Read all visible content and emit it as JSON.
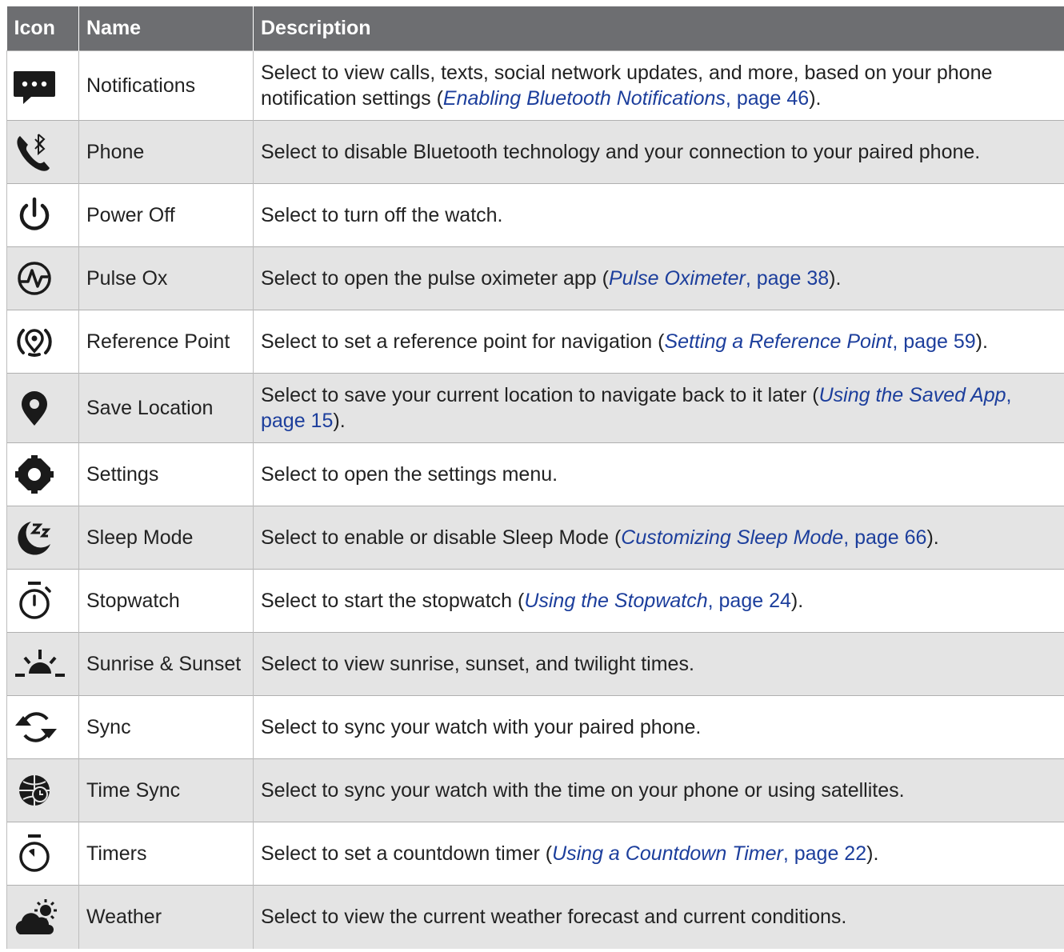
{
  "table": {
    "headers": {
      "icon": "Icon",
      "name": "Name",
      "description": "Description"
    },
    "rows": [
      {
        "icon": "notifications-icon",
        "name": "Notifications",
        "desc_before": "Select to view calls, texts, social network updates, and more, based on your phone notification settings (",
        "link_title": "Enabling Bluetooth Notifications",
        "link_page": ", page 46",
        "desc_after": ")."
      },
      {
        "icon": "phone-bluetooth-icon",
        "name": "Phone",
        "desc_before": "Select to disable Bluetooth technology and your connection to your paired phone.",
        "link_title": "",
        "link_page": "",
        "desc_after": ""
      },
      {
        "icon": "power-icon",
        "name": "Power Off",
        "desc_before": "Select to turn off the watch.",
        "link_title": "",
        "link_page": "",
        "desc_after": ""
      },
      {
        "icon": "pulse-ox-icon",
        "name": "Pulse Ox",
        "desc_before": "Select to open the pulse oximeter app (",
        "link_title": "Pulse Oximeter",
        "link_page": ", page 38",
        "desc_after": ")."
      },
      {
        "icon": "reference-point-icon",
        "name": "Reference Point",
        "desc_before": "Select to set a reference point for navigation (",
        "link_title": "Setting a Reference Point",
        "link_page": ", page 59",
        "desc_after": ")."
      },
      {
        "icon": "location-pin-icon",
        "name": "Save Location",
        "desc_before": "Select to save your current location to navigate back to it later (",
        "link_title": "Using the Saved App",
        "link_page": ", page 15",
        "desc_after": ")."
      },
      {
        "icon": "gear-icon",
        "name": "Settings",
        "desc_before": "Select to open the settings menu.",
        "link_title": "",
        "link_page": "",
        "desc_after": ""
      },
      {
        "icon": "sleep-mode-icon",
        "name": "Sleep Mode",
        "desc_before": "Select to enable or disable Sleep Mode (",
        "link_title": "Customizing Sleep Mode",
        "link_page": ", page 66",
        "desc_after": ")."
      },
      {
        "icon": "stopwatch-icon",
        "name": "Stopwatch",
        "desc_before": "Select to start the stopwatch (",
        "link_title": "Using the Stopwatch",
        "link_page": ", page 24",
        "desc_after": ")."
      },
      {
        "icon": "sunrise-sunset-icon",
        "name": "Sunrise & Sunset",
        "desc_before": "Select to view sunrise, sunset, and twilight times.",
        "link_title": "",
        "link_page": "",
        "desc_after": ""
      },
      {
        "icon": "sync-icon",
        "name": "Sync",
        "desc_before": "Select to sync your watch with your paired phone.",
        "link_title": "",
        "link_page": "",
        "desc_after": ""
      },
      {
        "icon": "time-sync-icon",
        "name": "Time Sync",
        "desc_before": "Select to sync your watch with the time on your phone or using satellites.",
        "link_title": "",
        "link_page": "",
        "desc_after": ""
      },
      {
        "icon": "timer-icon",
        "name": "Timers",
        "desc_before": "Select to set a countdown timer (",
        "link_title": "Using a Countdown Timer",
        "link_page": ", page 22",
        "desc_after": ")."
      },
      {
        "icon": "weather-icon",
        "name": "Weather",
        "desc_before": "Select to view the current weather forecast and current conditions.",
        "link_title": "",
        "link_page": "",
        "desc_after": ""
      }
    ]
  },
  "colors": {
    "header_bg": "#6d6e71",
    "row_alt_bg": "#e4e4e4",
    "link": "#1c3e9c",
    "icon": "#1a1a1a"
  }
}
